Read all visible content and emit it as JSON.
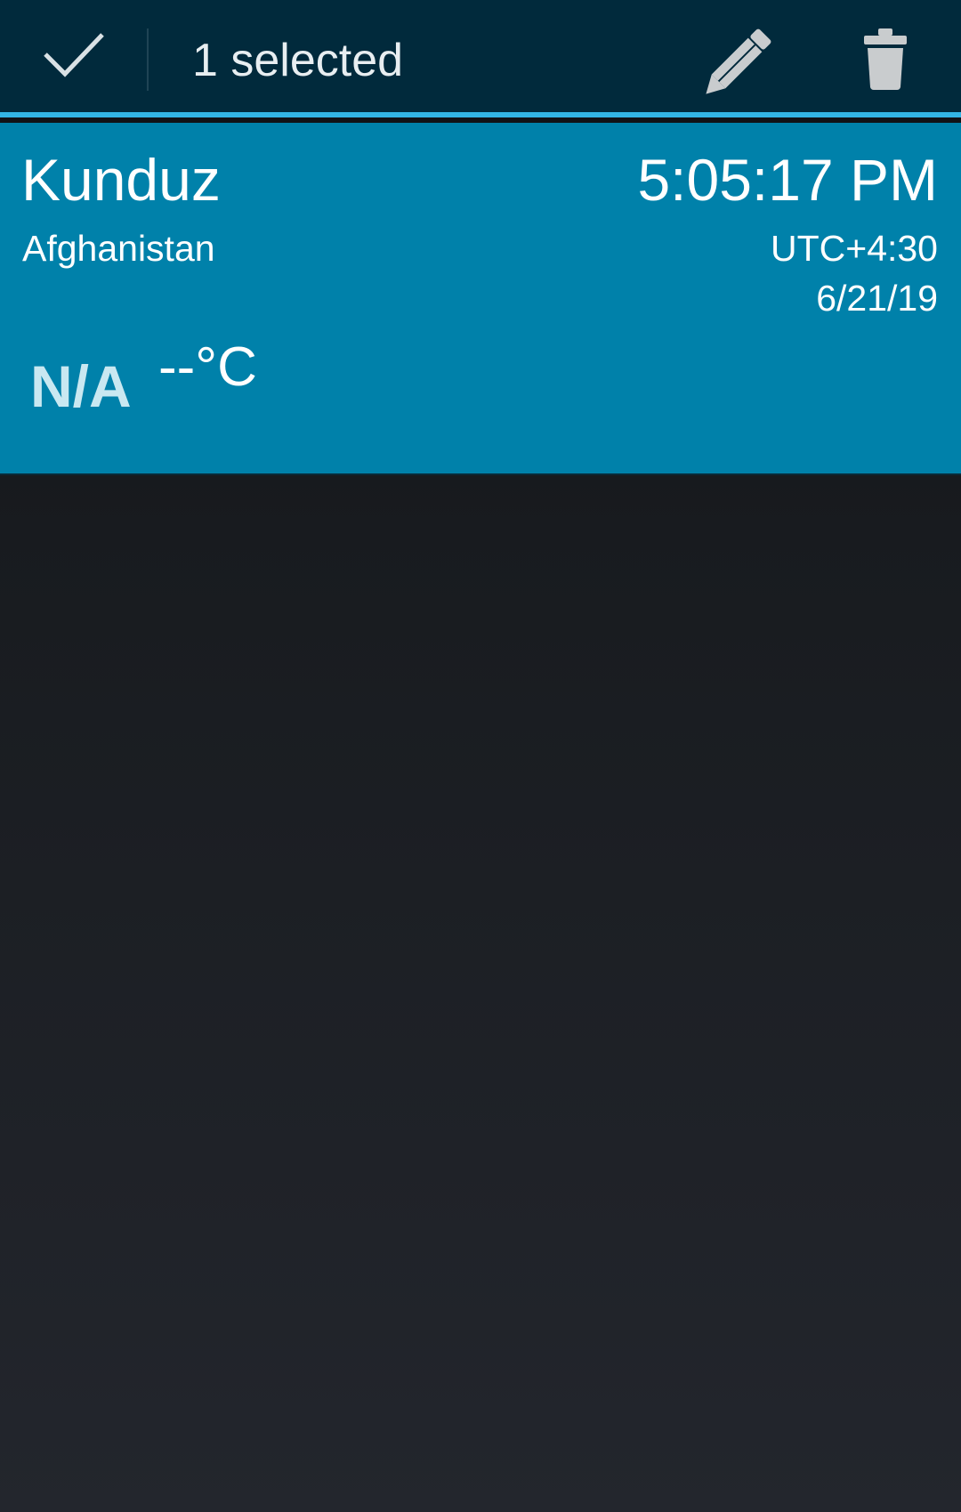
{
  "action_bar": {
    "selected_label": "1 selected",
    "accent_color": "#33b5e5",
    "background_color": "#012a3c",
    "done_icon": "checkmark-icon",
    "edit_icon": "pencil-icon",
    "delete_icon": "trash-icon"
  },
  "city_card": {
    "city": "Kunduz",
    "country": "Afghanistan",
    "time": "5:05:17 PM",
    "utc_offset": "UTC+4:30",
    "date": "6/21/19",
    "weather_condition": "N/A",
    "temperature": "--°C",
    "background_color": "#0081aa"
  }
}
